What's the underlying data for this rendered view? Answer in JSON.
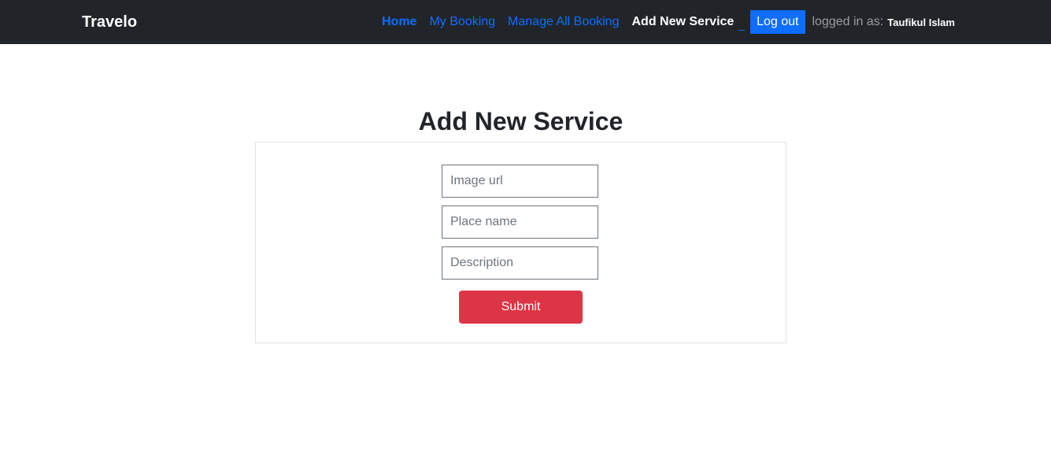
{
  "navbar": {
    "brand": "Travelo",
    "links": [
      {
        "label": "Home"
      },
      {
        "label": "My Booking"
      },
      {
        "label": "Manage All Booking"
      },
      {
        "label": "Add New Service"
      }
    ],
    "separator": "_",
    "logout_label": "Log out",
    "logged_in_label": "logged in as:",
    "user_name": "Taufikul Islam",
    "colors": {
      "background": "#212529",
      "link": "#0d6efd",
      "active_link": "#ffffff"
    }
  },
  "main": {
    "title": "Add New Service",
    "form": {
      "fields": [
        {
          "placeholder": "Image url",
          "value": ""
        },
        {
          "placeholder": "Place name",
          "value": ""
        },
        {
          "placeholder": "Description",
          "value": ""
        }
      ],
      "submit_label": "Submit",
      "submit_color": "#dc3545"
    }
  }
}
